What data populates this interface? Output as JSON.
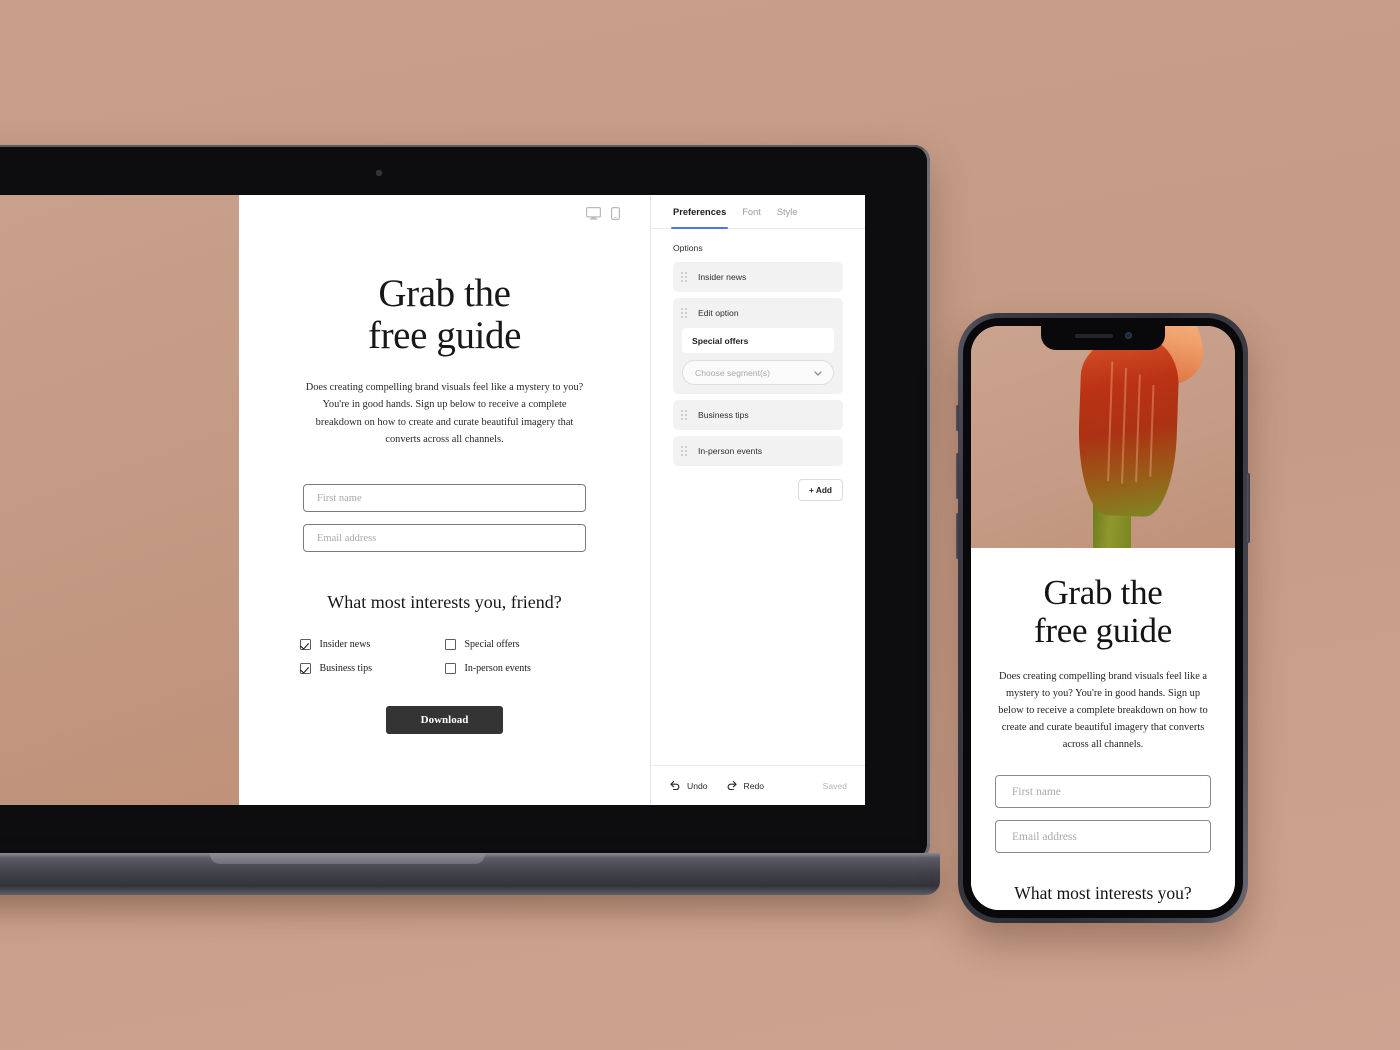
{
  "theme": {
    "background": "#c59b85",
    "accent": "#4a78f0",
    "button_dark": "#343434",
    "panel_card": "#f2f2f3"
  },
  "editor": {
    "tabs": [
      {
        "label": "Preferences",
        "active": true
      },
      {
        "label": "Font",
        "active": false
      },
      {
        "label": "Style",
        "active": false
      }
    ],
    "section_label": "Options",
    "options": [
      {
        "label": "Insider news",
        "expanded": false
      },
      {
        "label": "Edit option",
        "expanded": true,
        "value": "Special offers",
        "segment_placeholder": "Choose segment(s)"
      },
      {
        "label": "Business tips",
        "expanded": false
      },
      {
        "label": "In-person events",
        "expanded": false
      }
    ],
    "add_label": "+ Add",
    "footer": {
      "undo_label": "Undo",
      "redo_label": "Redo",
      "status": "Saved"
    },
    "device_toggle": {
      "desktop_icon": "monitor-icon",
      "mobile_icon": "mobile-icon"
    }
  },
  "landing_page": {
    "title_line1": "Grab the",
    "title_line2": "free guide",
    "description": "Does creating compelling brand visuals feel like a mystery to you? You're in good hands. Sign up below to receive a complete breakdown on how to create and curate beautiful imagery that converts across all channels.",
    "fields": {
      "first_name_placeholder": "First name",
      "email_placeholder": "Email address"
    },
    "question": "What most interests you, friend?",
    "checkboxes": [
      {
        "label": "Insider news",
        "checked": true
      },
      {
        "label": "Special offers",
        "checked": false
      },
      {
        "label": "Business tips",
        "checked": true
      },
      {
        "label": "In-person events",
        "checked": false
      }
    ],
    "submit_label": "Download"
  },
  "mobile_preview": {
    "title_line1": "Grab the",
    "title_line2": "free guide",
    "description": "Does creating compelling brand visuals feel like a mystery to you? You're in good hands. Sign up below to receive a complete breakdown on how to create and curate beautiful imagery that converts across all channels.",
    "fields": {
      "first_name_placeholder": "First name",
      "email_placeholder": "Email address"
    },
    "question": "What most interests you?"
  }
}
